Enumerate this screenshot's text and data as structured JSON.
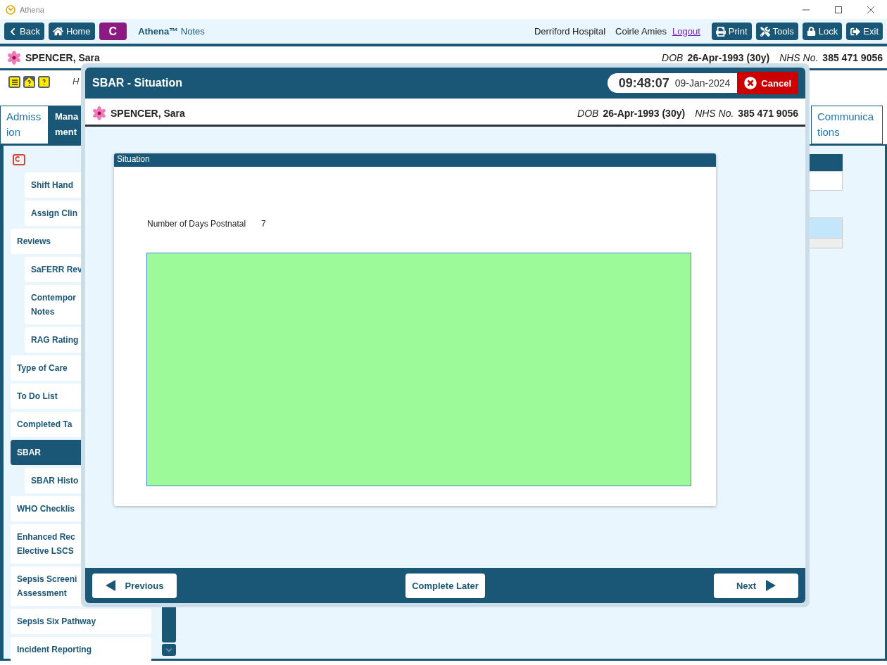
{
  "window": {
    "title": "Athena"
  },
  "toolbar": {
    "left_buttons": [
      {
        "kind": "back",
        "label": "Back"
      },
      {
        "kind": "home",
        "label": "Home"
      },
      {
        "kind": "badge",
        "label": "C"
      }
    ],
    "app_name": "**Athena™** Notes",
    "site": "Derriford Hospital",
    "user": "Coirle Amies",
    "logout": "Logout",
    "right_buttons": [
      {
        "kind": "print",
        "label": "Print"
      },
      {
        "kind": "tools",
        "label": "Tools"
      },
      {
        "kind": "lock",
        "label": "Lock"
      },
      {
        "kind": "exit",
        "label": "Exit"
      }
    ]
  },
  "patient": {
    "name": "SPENCER, Sara",
    "dob_label": "DOB",
    "dob": "26-Apr-1993 (30y)",
    "nhs_label": "NHS No.",
    "nhs": "385 471 9056"
  },
  "info_text": "H",
  "tabs": [
    {
      "label": "Admiss\nion",
      "selected": false
    },
    {
      "label": "Mana\nment",
      "selected": true
    },
    {
      "label": "Communica\ntions",
      "selected": false
    }
  ],
  "sidebar": {
    "items": [
      {
        "kind": "sub",
        "label": "Shift Hand",
        "selected": false
      },
      {
        "kind": "sub",
        "label": "Assign Clin",
        "selected": false
      },
      {
        "kind": "main",
        "label": "Reviews",
        "selected": false
      },
      {
        "kind": "sub",
        "label": "SaFERR Rev",
        "selected": false
      },
      {
        "kind": "sub",
        "label": "Contempor\nNotes",
        "selected": false
      },
      {
        "kind": "sub",
        "label": "RAG Rating",
        "selected": false
      },
      {
        "kind": "main",
        "label": "Type of Care",
        "selected": false
      },
      {
        "kind": "main",
        "label": "To Do List",
        "selected": false
      },
      {
        "kind": "main",
        "label": "Completed Ta",
        "selected": false
      },
      {
        "kind": "main",
        "label": "SBAR",
        "selected": true
      },
      {
        "kind": "sub",
        "label": "SBAR Histo",
        "selected": false
      },
      {
        "kind": "main",
        "label": "WHO Checklis",
        "selected": false
      },
      {
        "kind": "main",
        "label": "Enhanced Rec\nElective LSCS",
        "selected": false
      },
      {
        "kind": "main",
        "label": "Sepsis Screeni\nAssessment",
        "selected": false
      },
      {
        "kind": "main",
        "label": "Sepsis Six Pathway",
        "selected": false
      },
      {
        "kind": "main",
        "label": "Incident Reporting",
        "selected": false
      }
    ]
  },
  "modal": {
    "title": "SBAR - Situation",
    "time": "09:48:07",
    "date": "09-Jan-2024",
    "cancel": "Cancel",
    "patient": {
      "name": "SPENCER, Sara",
      "dob_label": "DOB",
      "dob": "26-Apr-1993 (30y)",
      "nhs_label": "NHS No.",
      "nhs": "385 471 9056"
    },
    "section": {
      "title": "Situation",
      "field_label": "Number of Days Postnatal",
      "field_value": "7"
    },
    "footer": {
      "previous": "Previous",
      "complete_later": "Complete Later",
      "next": "Next"
    }
  }
}
